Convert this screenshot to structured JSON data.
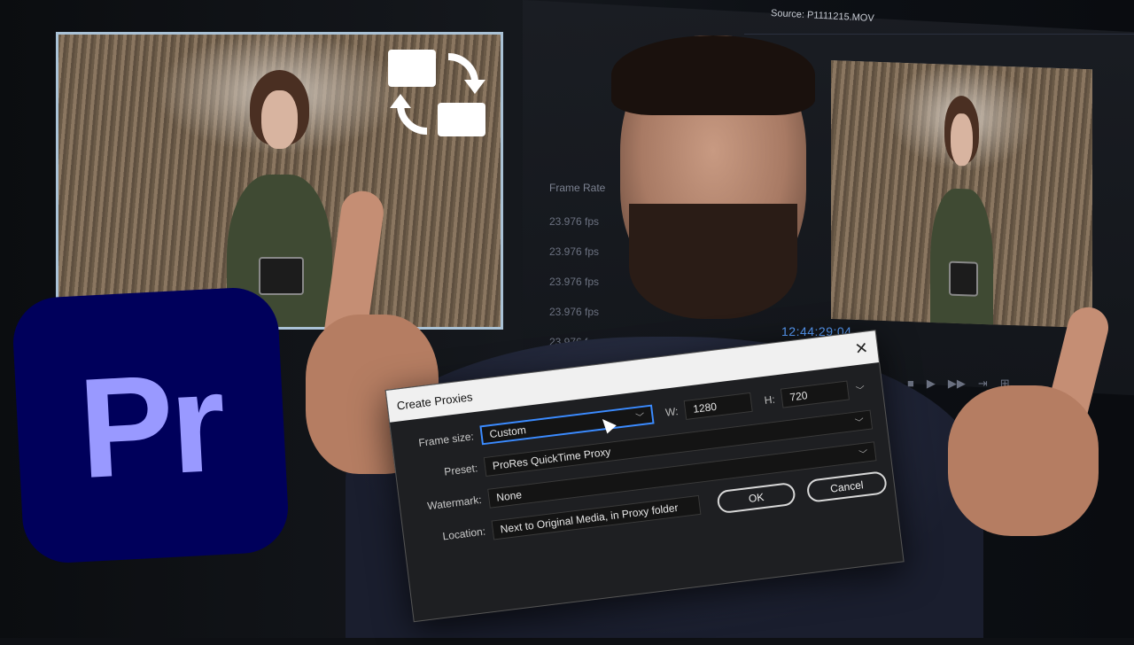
{
  "editor": {
    "source_tab": "Source: P1111215.MOV",
    "frame_rate_header": "Frame Rate",
    "frame_rates": [
      "23.976 fps",
      "23.976 fps",
      "23.976 fps",
      "23.976 fps",
      "23.976 fps"
    ],
    "timecode": "12:44:29:04",
    "controls": [
      "◀",
      "■",
      "▶",
      "▶▶",
      "⇥",
      "⊞"
    ]
  },
  "logo": {
    "text": "Pr",
    "color": "#9999ff",
    "background": "#00005b"
  },
  "icons": {
    "proxy_swap": "proxy-swap-icon",
    "close": "close-icon",
    "cursor": "mouse-cursor-icon"
  },
  "dialog": {
    "title": "Create Proxies",
    "close_glyph": "✕",
    "frame_size_label": "Frame size:",
    "frame_size_value": "Custom",
    "width_label": "W:",
    "width_value": "1280",
    "height_label": "H:",
    "height_value": "720",
    "preset_label": "Preset:",
    "preset_value": "ProRes QuickTime Proxy",
    "watermark_label": "Watermark:",
    "watermark_value": "None",
    "location_label": "Location:",
    "location_value": "Next to Original Media, in Proxy folder",
    "ok_label": "OK",
    "cancel_label": "Cancel",
    "chevron": "﹀"
  },
  "colors": {
    "accent": "#3b8bff",
    "timecode": "#5aa0ff",
    "thumb_border": "#aac2d6"
  }
}
